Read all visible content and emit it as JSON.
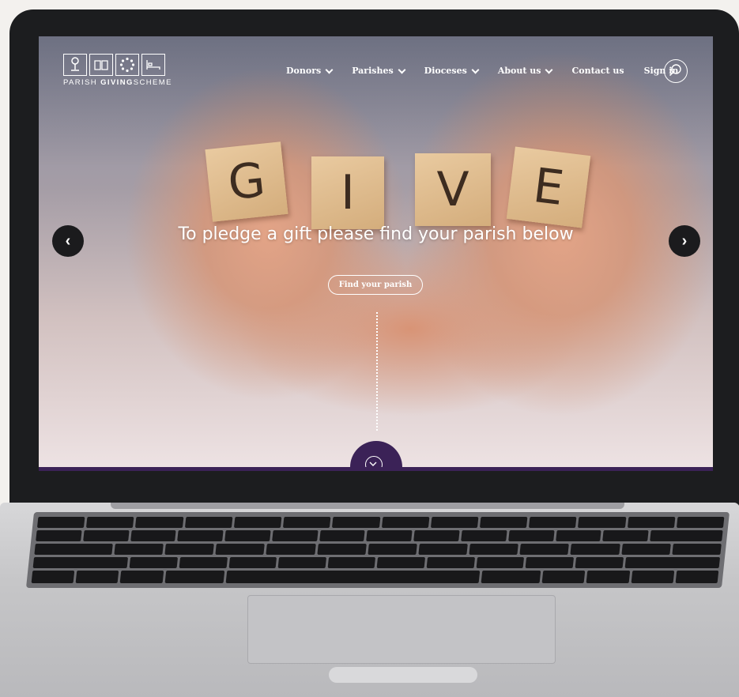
{
  "logo": {
    "text_regular": "PARISH ",
    "text_bold": "GIVING",
    "text_tail": "SCHEME"
  },
  "nav": {
    "items": [
      {
        "label": "Donors",
        "has_dropdown": true
      },
      {
        "label": "Parishes",
        "has_dropdown": true
      },
      {
        "label": "Dioceses",
        "has_dropdown": true
      },
      {
        "label": "About us",
        "has_dropdown": true
      },
      {
        "label": "Contact us",
        "has_dropdown": false
      },
      {
        "label": "Sign in",
        "has_dropdown": false
      }
    ]
  },
  "hero": {
    "tiles": [
      "G",
      "I",
      "V",
      "E"
    ],
    "headline": "To pledge a gift please find your parish below",
    "cta_label": "Find your parish",
    "prev_label": "‹",
    "next_label": "›"
  },
  "colors": {
    "accent": "#3b2257",
    "bezel": "#1c1d1f"
  }
}
